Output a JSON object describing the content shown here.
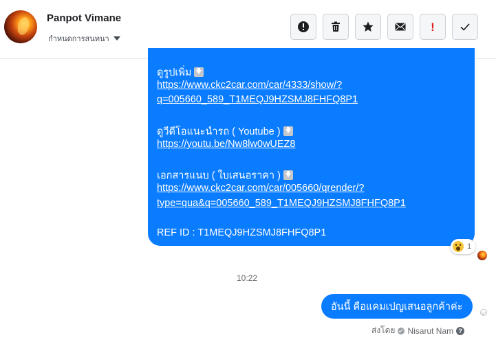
{
  "header": {
    "name": "Panpot Vimane",
    "subtitle": "กำหนดการสนทนา",
    "actions": [
      {
        "id": "mark-spam",
        "icon": "exclamation-circle-icon"
      },
      {
        "id": "delete",
        "icon": "trash-icon"
      },
      {
        "id": "star",
        "icon": "star-icon"
      },
      {
        "id": "mark-unread",
        "icon": "envelope-icon"
      },
      {
        "id": "flag-important",
        "icon": "red-exclamation-icon",
        "label": "!"
      },
      {
        "id": "mark-done",
        "icon": "check-icon"
      }
    ]
  },
  "message_big": {
    "line_photos_label": "ดูรูปเพิ่ม",
    "line_photos_url_1": "https://www.ckc2car.com/car/4333/show/?",
    "line_photos_url_2": "q=005660_589_T1MEQJ9HZSMJ8FHFQ8P1",
    "line_video_label": "ดูวีดีโอแนะนำรถ ( Youtube )",
    "line_video_url": "https://youtu.be/Nw8lw0wUEZ8",
    "line_doc_label": "เอกสารแนบ ( ใบเสนอราคา )",
    "line_doc_url_1": "https://www.ckc2car.com/car/005660/qrender/?",
    "line_doc_url_2": "type=qua&q=005660_589_T1MEQJ9HZSMJ8FHFQ8P1",
    "ref": "REF ID : T1MEQJ9HZSMJ8FHFQ8P1"
  },
  "reaction": {
    "icon": "wow-emoji-icon",
    "count": "1"
  },
  "timestamp": "10:22",
  "message_small": "อันนี้ คือแคมเปญเสนอลูกค้าค่ะ",
  "sent_by": {
    "prefix": "ส่งโดย",
    "name": "Nisarut Nam",
    "help": "?"
  },
  "colors": {
    "bubble": "#0a7cff",
    "flag": "#e02020"
  }
}
